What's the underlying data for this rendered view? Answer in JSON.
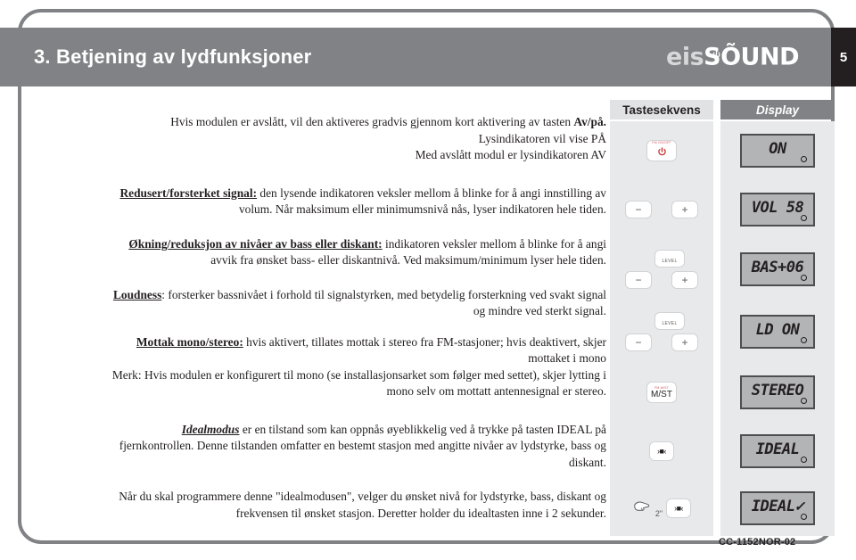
{
  "header": {
    "title": "3. Betjening av lydfunksjoner",
    "brand_first": "eis",
    "brand_second": "SÕUND",
    "brand_power_icon": "power-icon",
    "page_number": "5"
  },
  "body": {
    "p1_line1_a": "Hvis modulen er avslått, vil den aktiveres gradvis gjennom kort aktivering av tasten ",
    "p1_line1_b": "Av/på.",
    "p1_line2": "Lysindikatoren vil vise PÅ",
    "p1_line3": "Med avslått modul er lysindikatoren AV",
    "p2_heading": "Redusert/forsterket signal:",
    "p2_text": " den lysende indikatoren veksler mellom  å blinke for å angi innstilling av volum. Når maksimum eller minimumsnivå nås, lyser indikatoren hele tiden.",
    "p3_heading": "Økning/reduksjon av nivåer av bass eller diskant:",
    "p3_text": " indikatoren veksler mellom å blinke for å angi avvik fra ønsket bass- eller diskantnivå. Ved maksimum/minimum lyser hele tiden.",
    "p4_heading": "Loudness",
    "p4_text": ": forsterker bassnivået i forhold til signalstyrken, med betydelig forsterkning ved svakt signal og mindre ved sterkt signal.",
    "p5_heading": "Mottak mono/stereo:",
    "p5_text": " hvis aktivert, tillates mottak i stereo fra FM-stasjoner; hvis deaktivert, skjer mottaket i mono",
    "p5_note": "Merk: Hvis modulen er konfigurert til mono (se installasjonsarket som følger med settet), skjer lytting i mono selv om mottatt antennesignal er stereo.",
    "p6_heading": "Idealmodus",
    "p6_text": " er en tilstand som kan oppnås øyeblikkelig ved å trykke på tasten IDEAL på fjernkontrollen. Denne tilstanden omfatter en bestemt stasjon med angitte nivåer av lydstyrke, bass og diskant.",
    "p7_text": "Når du skal programmere denne \"idealmodusen\", velger du ønsket nivå for lydstyrke, bass, diskant og frekvensen til ønsket stasjon. Deretter holder du idealtasten inne i 2 sekunder."
  },
  "table": {
    "header_keys": "Tastesekvens",
    "header_display": "Display",
    "rows": [
      {
        "key_type": "power",
        "key_small_label": "FM ON/OFF",
        "key_icon": "power-icon",
        "display_text": "ON"
      },
      {
        "key_type": "minus-plus",
        "key_minus": "−",
        "key_plus": "+",
        "display_text": "VOL 58"
      },
      {
        "key_type": "level-minus-plus",
        "key_level": "LEVEL",
        "key_minus": "−",
        "key_plus": "+",
        "display_text": "BAS+06"
      },
      {
        "key_type": "level-minus-plus",
        "key_level": "LEVEL",
        "key_minus": "−",
        "key_plus": "+",
        "display_text": "LD ON"
      },
      {
        "key_type": "mst",
        "key_small_label": "FM M/ST",
        "key_label": "M/ST",
        "display_text": "STEREO"
      },
      {
        "key_type": "ideal",
        "key_label": "›■‹",
        "display_text": "IDEAL"
      },
      {
        "key_type": "hold-ideal",
        "hold_icon": "pointing-hand-icon",
        "hold_duration": "2\"",
        "key_label": "›■‹",
        "display_text": "IDEAL✓"
      }
    ]
  },
  "footer": {
    "code": "CC-1152NOR-02"
  },
  "colors": {
    "header_gray": "#808285",
    "page_number_black": "#231f20",
    "column_bg": "#e8e9eb",
    "lcd_bg": "#b3b4b6",
    "accent_red": "#d4565c"
  }
}
